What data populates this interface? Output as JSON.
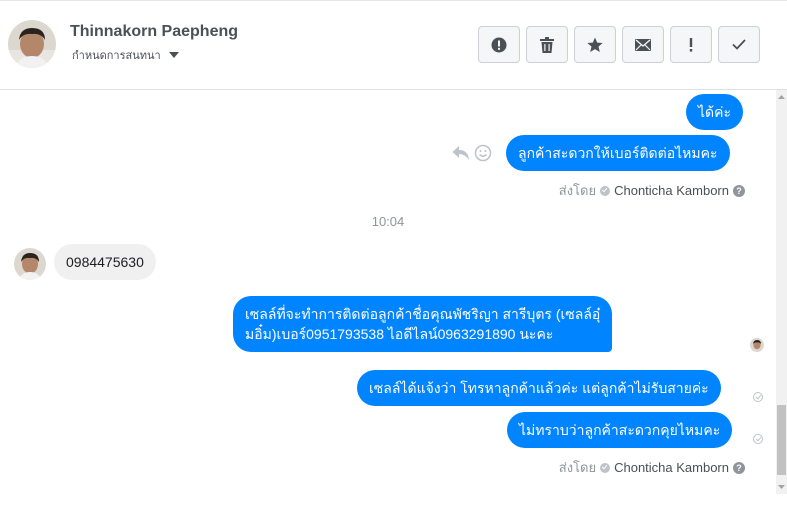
{
  "header": {
    "contact_name": "Thinnakorn Paepheng",
    "contact_sub": "กำหนดการสนทนา",
    "toolbar": [
      {
        "icon": "alert-circle-icon"
      },
      {
        "icon": "trash-icon"
      },
      {
        "icon": "star-icon"
      },
      {
        "icon": "envelope-icon"
      },
      {
        "icon": "exclamation-icon"
      },
      {
        "icon": "checkmark-icon"
      }
    ]
  },
  "messages": {
    "m1": "ได้ค่ะ",
    "m2": "ลูกค้าสะดวกให้เบอร์ติดต่อไหมคะ",
    "sent_by_1": {
      "prefix": "ส่งโดย",
      "name": "Chonticha Kamborn"
    },
    "timestamp": "10:04",
    "incoming_1": "0984475630",
    "m3_line1": "เซลล์ที่จะทำการติดต่อลูกค้าชื่อคุณพัชริญา สารีบุตร (เซลล์อุ๋",
    "m3_line2": "มอิ๋ม)เบอร์0951793538 ไอดีไลน์0963291890 นะคะ",
    "m4": "เซลล์ได้แจ้งว่า โทรหาลูกค้าแล้วค่ะ แต่ลูกค้าไม่รับสายค่ะ",
    "m5": "ไม่ทราบว่าลูกค้าสะดวกคุยไหมคะ",
    "sent_by_2": {
      "prefix": "ส่งโดย",
      "name": "Chonticha Kamborn"
    }
  },
  "colors": {
    "outgoing_bubble": "#0084ff",
    "incoming_bubble": "#f1f0f0",
    "muted_text": "#90949c"
  }
}
